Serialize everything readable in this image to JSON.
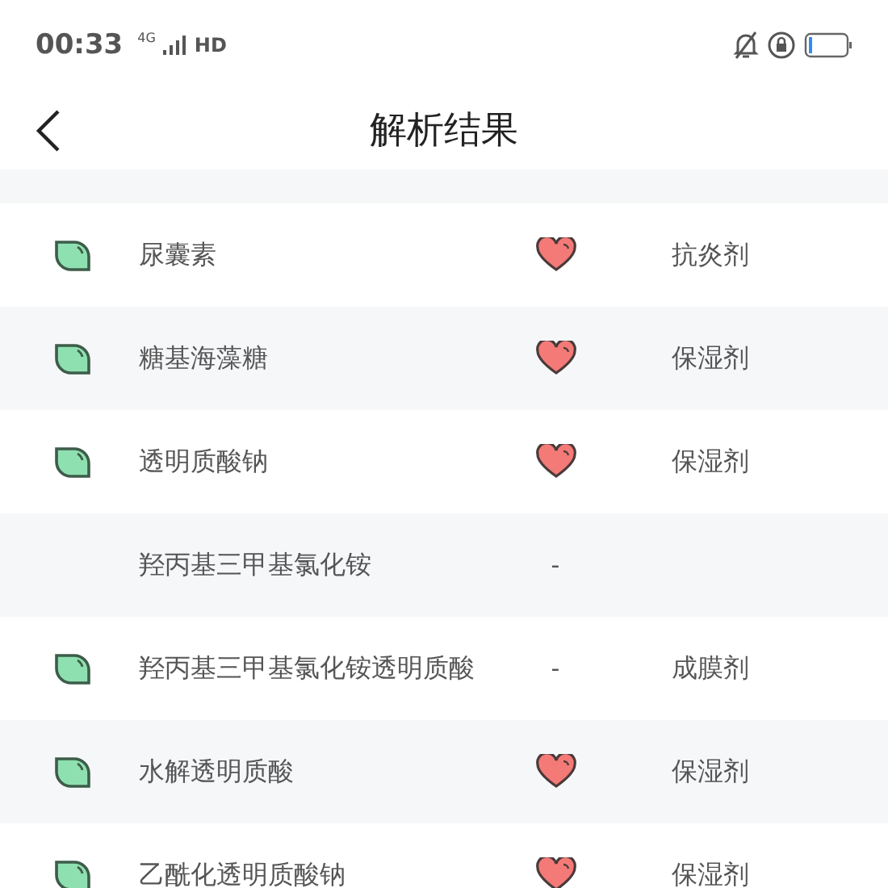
{
  "status_bar": {
    "time": "00:33",
    "network": "4G",
    "hd": "HD"
  },
  "header": {
    "title": "解析结果"
  },
  "rows": [
    {
      "name": "尿囊素",
      "leaf": true,
      "indicator": {
        "kind": "heart"
      },
      "function": "抗炎剂"
    },
    {
      "name": "糖基海藻糖",
      "leaf": true,
      "indicator": {
        "kind": "heart"
      },
      "function": "保湿剂"
    },
    {
      "name": "透明质酸钠",
      "leaf": true,
      "indicator": {
        "kind": "heart"
      },
      "function": "保湿剂"
    },
    {
      "name": "羟丙基三甲基氯化铵",
      "leaf": false,
      "indicator": {
        "kind": "text",
        "text": "-"
      }
    },
    {
      "name": "羟丙基三甲基氯化铵透明质酸",
      "leaf": true,
      "indicator": {
        "kind": "text",
        "text": "-"
      },
      "function": "成膜剂"
    },
    {
      "name": "水解透明质酸",
      "leaf": true,
      "indicator": {
        "kind": "heart"
      },
      "function": "保湿剂"
    },
    {
      "name": "乙酰化透明质酸钠",
      "leaf": true,
      "indicator": {
        "kind": "heart"
      },
      "function": "保湿剂"
    }
  ]
}
